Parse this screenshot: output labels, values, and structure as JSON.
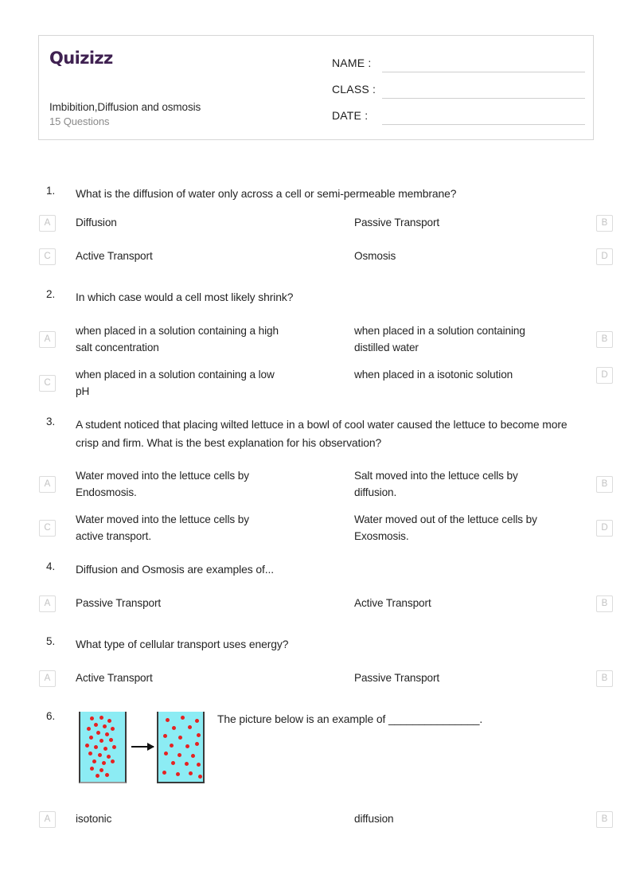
{
  "header": {
    "brand": "Quizizz",
    "brand_color": "#3f2151",
    "title": "Imbibition,Diffusion and osmosis",
    "subtitle": "15 Questions",
    "fields": [
      {
        "label": "NAME :",
        "value": ""
      },
      {
        "label": "CLASS :",
        "value": ""
      },
      {
        "label": "DATE  :",
        "value": ""
      }
    ]
  },
  "questions": [
    {
      "number": "1.",
      "text": "What is the diffusion of water only across a cell or semi-permeable membrane?",
      "options": [
        {
          "letter": "A",
          "text": "Diffusion"
        },
        {
          "letter": "B",
          "text": "Passive Transport"
        },
        {
          "letter": "C",
          "text": "Active Transport"
        },
        {
          "letter": "D",
          "text": "Osmosis"
        }
      ]
    },
    {
      "number": "2.",
      "text": "In which case would a cell most likely shrink?",
      "options": [
        {
          "letter": "A",
          "text": "when placed in a solution containing a high salt concentration"
        },
        {
          "letter": "B",
          "text": "when placed in a solution containing distilled water"
        },
        {
          "letter": "C",
          "text": "when placed in a solution containing a low pH"
        },
        {
          "letter": "D",
          "text": "when placed in a isotonic solution"
        }
      ]
    },
    {
      "number": "3.",
      "text": "A student noticed that placing wilted lettuce in a bowl of cool water caused the lettuce to become more crisp and firm. What is the best explanation for his observation?",
      "options": [
        {
          "letter": "A",
          "text": "Water moved into the lettuce cells by Endosmosis."
        },
        {
          "letter": "B",
          "text": "Salt moved into the lettuce cells by diffusion."
        },
        {
          "letter": "C",
          "text": "Water moved into the lettuce cells by active transport."
        },
        {
          "letter": "D",
          "text": "Water moved out of the lettuce cells by Exosmosis."
        }
      ]
    },
    {
      "number": "4.",
      "text": "Diffusion and Osmosis are examples of...",
      "options": [
        {
          "letter": "A",
          "text": "Passive Transport"
        },
        {
          "letter": "B",
          "text": "Active Transport"
        }
      ]
    },
    {
      "number": "5.",
      "text": "What type of cellular transport uses energy?",
      "options": [
        {
          "letter": "A",
          "text": "Active Transport"
        },
        {
          "letter": "B",
          "text": "Passive Transport"
        }
      ]
    },
    {
      "number": "6.",
      "text": "The picture below is an example of _______________.",
      "figure": {
        "name": "diffusion-beakers-diagram",
        "liquid_color": "#8cecf4",
        "particle_color": "#e52222",
        "beaker_left_label": "concentrated particles",
        "beaker_right_label": "dispersed particles",
        "arrow_direction": "right"
      },
      "options": [
        {
          "letter": "A",
          "text": "isotonic"
        },
        {
          "letter": "B",
          "text": "diffusion"
        }
      ]
    }
  ]
}
